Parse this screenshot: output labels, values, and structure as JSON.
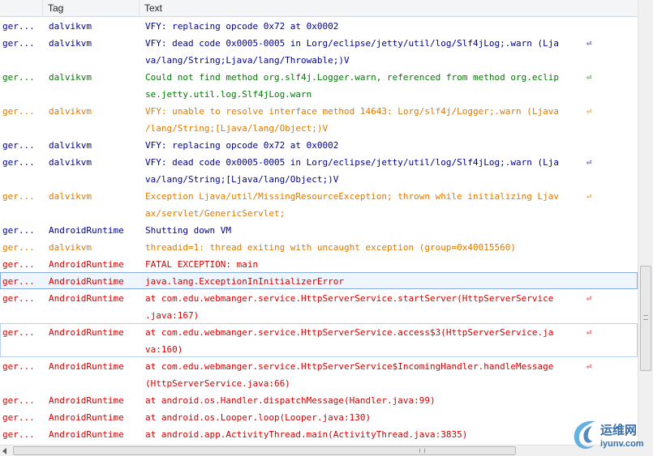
{
  "columns": {
    "app": "",
    "tag": "Tag",
    "text": "Text"
  },
  "wrap_marker": "⏎",
  "colors": {
    "verbose": "#1a1a1a",
    "debug": "#00008b",
    "info": "#007a00",
    "warn": "#e07800",
    "error": "#d40000",
    "selection": "#eef5fd"
  },
  "rows": [
    {
      "level": "D",
      "app": "ger...",
      "tag": "dalvikvm",
      "lines": [
        "VFY: replacing opcode 0x72 at 0x0002"
      ]
    },
    {
      "level": "D",
      "app": "ger...",
      "tag": "dalvikvm",
      "lines": [
        "VFY: dead code 0x0005-0005 in Lorg/eclipse/jetty/util/log/Slf4jLog;.warn (Lja",
        "va/lang/String;Ljava/lang/Throwable;)V"
      ]
    },
    {
      "level": "I",
      "app": "ger...",
      "tag": "dalvikvm",
      "lines": [
        "Could not find method org.slf4j.Logger.warn, referenced from method org.eclip",
        "se.jetty.util.log.Slf4jLog.warn"
      ]
    },
    {
      "level": "W",
      "app": "ger...",
      "tag": "dalvikvm",
      "lines": [
        "VFY: unable to resolve interface method 14643: Lorg/slf4j/Logger;.warn (Ljava",
        "/lang/String;[Ljava/lang/Object;)V"
      ]
    },
    {
      "level": "D",
      "app": "ger...",
      "tag": "dalvikvm",
      "lines": [
        "VFY: replacing opcode 0x72 at 0x0002"
      ]
    },
    {
      "level": "D",
      "app": "ger...",
      "tag": "dalvikvm",
      "lines": [
        "VFY: dead code 0x0005-0005 in Lorg/eclipse/jetty/util/log/Slf4jLog;.warn (Lja",
        "va/lang/String;[Ljava/lang/Object;)V"
      ]
    },
    {
      "level": "W",
      "app": "ger...",
      "tag": "dalvikvm",
      "lines": [
        "Exception Ljava/util/MissingResourceException; thrown while initializing Ljav",
        "ax/servlet/GenericServlet;"
      ]
    },
    {
      "level": "D",
      "app": "ger...",
      "tag": "AndroidRuntime",
      "lines": [
        "Shutting down VM"
      ]
    },
    {
      "level": "W",
      "app": "ger...",
      "tag": "dalvikvm",
      "lines": [
        "threadid=1: thread exiting with uncaught exception (group=0x40015560)"
      ]
    },
    {
      "level": "E",
      "app": "ger...",
      "tag": "AndroidRuntime",
      "lines": [
        "FATAL EXCEPTION: main"
      ]
    },
    {
      "level": "E",
      "app": "ger...",
      "tag": "AndroidRuntime",
      "lines": [
        "java.lang.ExceptionInInitializerError"
      ],
      "state": "selected"
    },
    {
      "level": "E",
      "app": "ger...",
      "tag": "AndroidRuntime",
      "lines": [
        "at com.edu.webmanger.service.HttpServerService.startServer(HttpServerService",
        ".java:167)"
      ]
    },
    {
      "level": "E",
      "app": "ger...",
      "tag": "AndroidRuntime",
      "lines": [
        "at com.edu.webmanger.service.HttpServerService.access$3(HttpServerService.ja",
        "va:160)"
      ],
      "state": "focused"
    },
    {
      "level": "E",
      "app": "ger...",
      "tag": "AndroidRuntime",
      "lines": [
        "at com.edu.webmanger.service.HttpServerService$IncomingHandler.handleMessage",
        "(HttpServerService.java:66)"
      ]
    },
    {
      "level": "E",
      "app": "ger...",
      "tag": "AndroidRuntime",
      "lines": [
        "at android.os.Handler.dispatchMessage(Handler.java:99)"
      ]
    },
    {
      "level": "E",
      "app": "ger...",
      "tag": "AndroidRuntime",
      "lines": [
        "at android.os.Looper.loop(Looper.java:130)"
      ]
    },
    {
      "level": "E",
      "app": "ger...",
      "tag": "AndroidRuntime",
      "lines": [
        "at android.app.ActivityThread.main(ActivityThread.java:3835)"
      ]
    }
  ],
  "watermark": {
    "cn": "运维网",
    "domain": "iyunv.com"
  }
}
